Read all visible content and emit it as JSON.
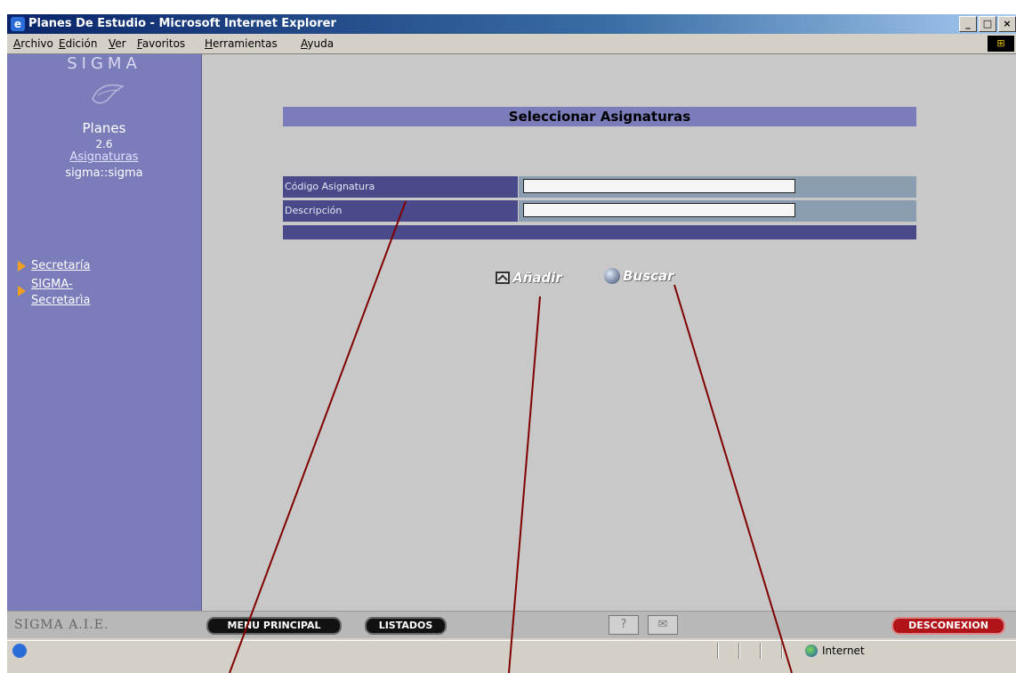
{
  "window": {
    "title": "Planes De Estudio - Microsoft Internet Explorer"
  },
  "menu": [
    "Archivo",
    "Edición",
    "Ver",
    "Favoritos",
    "Herramientas",
    "Ayuda"
  ],
  "sidebar": {
    "brand": "SIGMA",
    "app_name": "Planes",
    "version": "2.6",
    "section_link": "Asignaturas",
    "user": "sigma::sigma",
    "nav": [
      "Secretaría",
      "SIGMA-Secretarìa"
    ]
  },
  "form": {
    "title": "Seleccionar Asignaturas",
    "fields": [
      {
        "label": "Código Asignatura",
        "value": ""
      },
      {
        "label": "Descripción",
        "value": ""
      }
    ],
    "add_label": "Añadir",
    "search_label": "Buscar"
  },
  "toolbar": {
    "brand": "SIGMA A.I.E.",
    "main_menu": "MENU PRINCIPAL",
    "listados": "LISTADOS",
    "help": "?",
    "mail": "✉",
    "logout": "DESCONEXION"
  },
  "status": {
    "zone": "Internet"
  },
  "colors": {
    "annotation": "#800000",
    "sidebar": "#7b7cba",
    "label_bg": "#4a4a8a"
  }
}
